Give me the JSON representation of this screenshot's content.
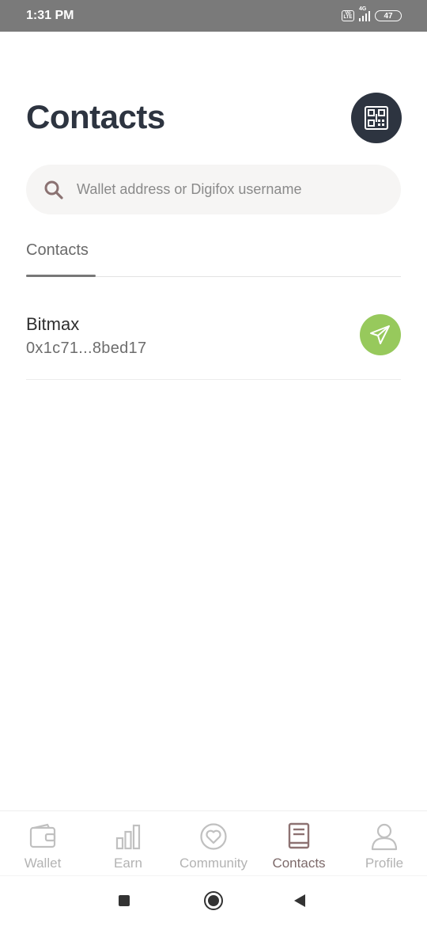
{
  "status_bar": {
    "time": "1:31 PM",
    "volte": "Vo LTE",
    "network": "4G",
    "battery": "47"
  },
  "header": {
    "title": "Contacts",
    "qr_icon": "qr-scan-icon"
  },
  "search": {
    "placeholder": "Wallet address or Digifox username",
    "value": ""
  },
  "tabs": [
    {
      "label": "Contacts",
      "active": true
    }
  ],
  "contacts": [
    {
      "name": "Bitmax",
      "address": "0x1c71...8bed17",
      "action_icon": "send-icon"
    }
  ],
  "bottom_nav": [
    {
      "label": "Wallet",
      "icon": "wallet-icon",
      "active": false
    },
    {
      "label": "Earn",
      "icon": "bar-chart-icon",
      "active": false
    },
    {
      "label": "Community",
      "icon": "heart-icon",
      "active": false
    },
    {
      "label": "Contacts",
      "icon": "address-book-icon",
      "active": true
    },
    {
      "label": "Profile",
      "icon": "person-icon",
      "active": false
    }
  ],
  "colors": {
    "title": "#2d3440",
    "send_button": "#97c95c",
    "active_nav": "#7d6a6a",
    "inactive_nav": "#b3b3b3"
  }
}
